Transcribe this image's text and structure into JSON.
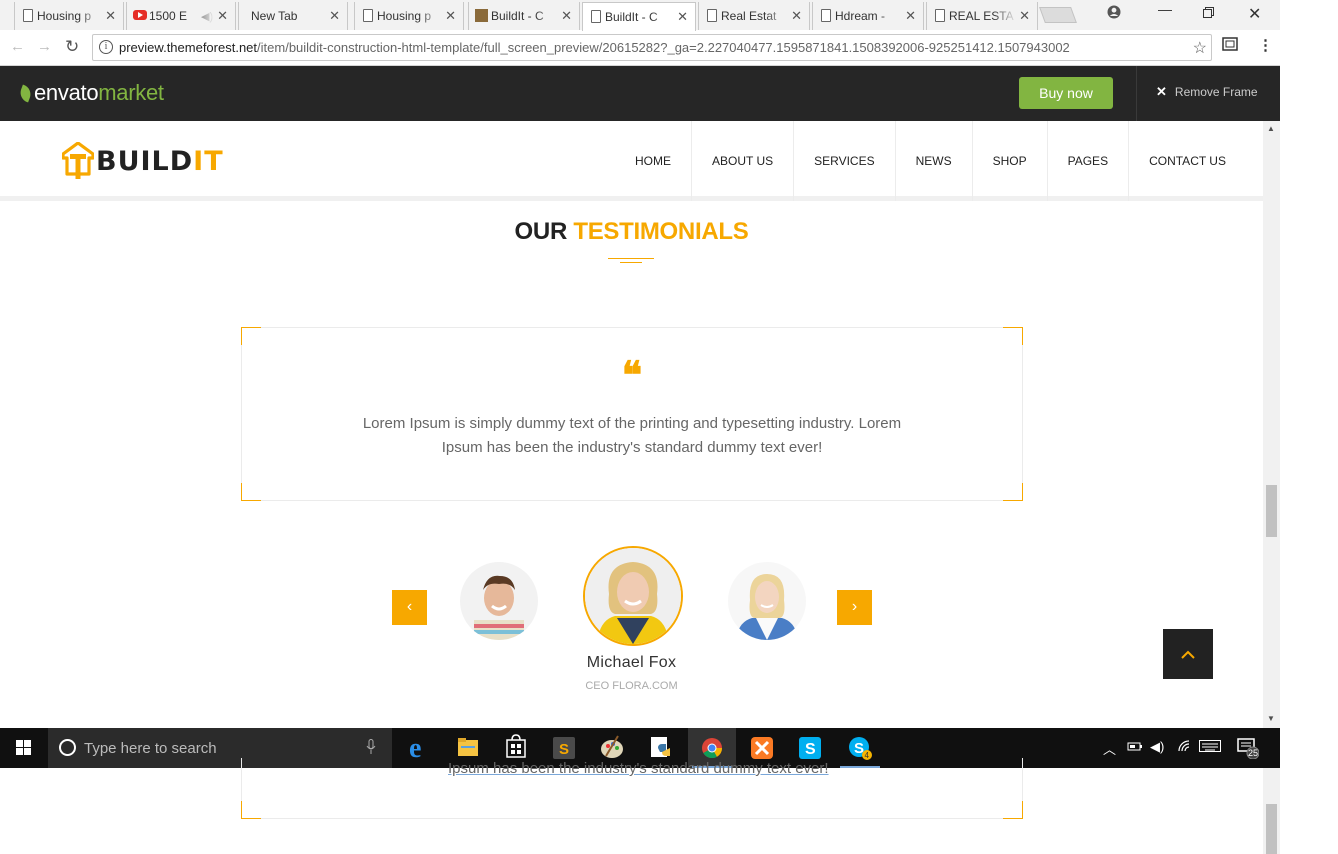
{
  "browser": {
    "tabs": [
      {
        "title": "Housing p",
        "icon": "page-icon"
      },
      {
        "title": "1500 E",
        "icon": "youtube-icon",
        "audio": true
      },
      {
        "title": "New Tab",
        "icon": "none"
      },
      {
        "title": "Housing p",
        "icon": "page-icon"
      },
      {
        "title": "BuildIt - C",
        "icon": "image-icon"
      },
      {
        "title": "BuildIt - C",
        "icon": "page-icon",
        "active": true
      },
      {
        "title": "Real Estat",
        "icon": "page-icon"
      },
      {
        "title": "Hdream -",
        "icon": "page-icon"
      },
      {
        "title": "REAL ESTA",
        "icon": "page-icon"
      }
    ],
    "url_host": "preview.themeforest.net",
    "url_path": "/item/buildit-construction-html-template/full_screen_preview/20615282?_ga=2.227040477.1595871841.1508392006-925251412.1507943002"
  },
  "envato": {
    "logo_word": "envato",
    "logo_market": "market",
    "buy_label": "Buy now",
    "remove_frame_label": "Remove Frame",
    "brand_green": "#82b541"
  },
  "site": {
    "logo_main": "BUILD",
    "logo_accent": "IT",
    "accent_color": "#f7a800",
    "nav": [
      "HOME",
      "ABOUT US",
      "SERVICES",
      "NEWS",
      "SHOP",
      "PAGES",
      "CONTACT US"
    ]
  },
  "testimonials": {
    "title_main": "OUR",
    "title_accent": "TESTIMONIALS",
    "quote": "Lorem Ipsum is simply dummy text of the printing and typesetting industry. Lorem Ipsum has been the industry's standard dummy text ever!",
    "prev_icon": "chevron-left-icon",
    "next_icon": "chevron-right-icon",
    "person_name": "Michael Fox",
    "person_role": "CEO FLORA.COM"
  },
  "below_fold_text": "Ipsum has been the industry's standard dummy text ever!",
  "taskbar": {
    "search_placeholder": "Type here to search",
    "notification_count": "25",
    "apps": [
      "edge-icon",
      "file-explorer-icon",
      "store-icon",
      "sublime-icon",
      "paint-icon",
      "python-icon",
      "chrome-icon",
      "xampp-icon",
      "skype-icon",
      "skype-business-icon"
    ]
  }
}
